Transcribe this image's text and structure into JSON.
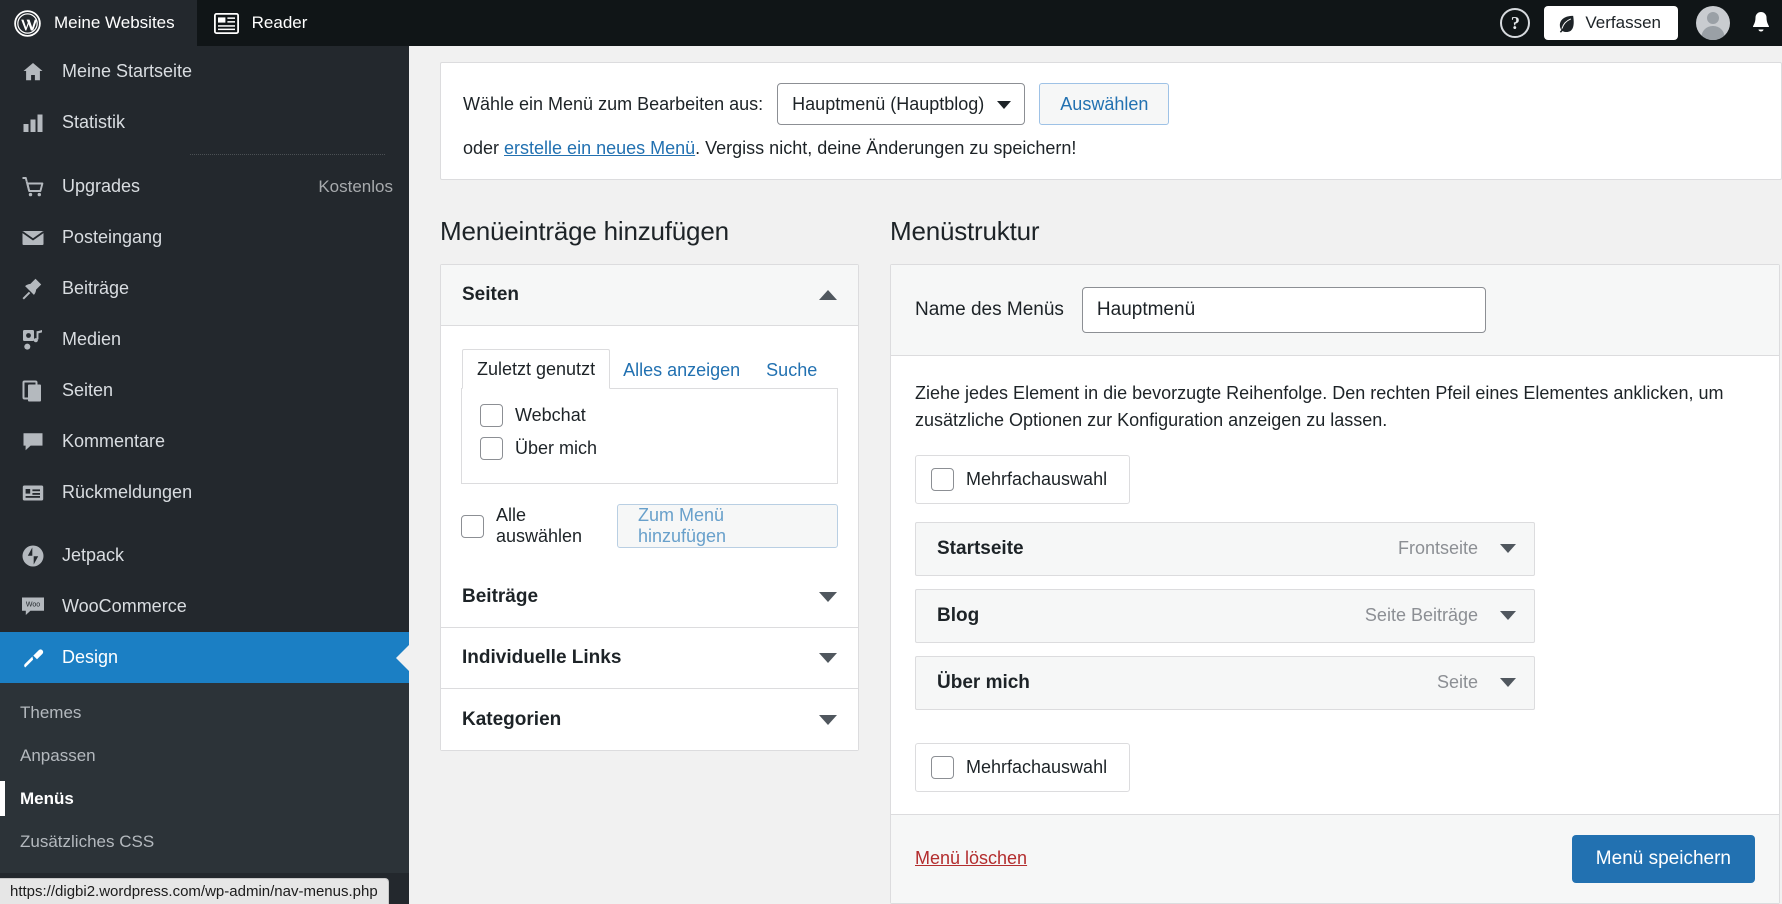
{
  "masterbar": {
    "sites_label": "Meine Websites",
    "reader_label": "Reader",
    "help_label": "?",
    "compose_label": "Verfassen"
  },
  "sidebar": {
    "items": [
      {
        "label": "Meine Startseite",
        "icon": "home-icon",
        "badge": ""
      },
      {
        "label": "Statistik",
        "icon": "bar-chart-icon",
        "badge": ""
      },
      {
        "label": "Upgrades",
        "icon": "cart-icon",
        "badge": "Kostenlos"
      },
      {
        "label": "Posteingang",
        "icon": "envelope-icon",
        "badge": ""
      },
      {
        "label": "Beiträge",
        "icon": "pin-icon",
        "badge": ""
      },
      {
        "label": "Medien",
        "icon": "media-icon",
        "badge": ""
      },
      {
        "label": "Seiten",
        "icon": "pages-icon",
        "badge": ""
      },
      {
        "label": "Kommentare",
        "icon": "comment-icon",
        "badge": ""
      },
      {
        "label": "Rückmeldungen",
        "icon": "feedback-icon",
        "badge": ""
      },
      {
        "label": "Jetpack",
        "icon": "jetpack-icon",
        "badge": ""
      },
      {
        "label": "WooCommerce",
        "icon": "woo-icon",
        "badge": ""
      }
    ],
    "selected": {
      "label": "Design",
      "icon": "brush-icon"
    },
    "submenu": [
      {
        "label": "Themes",
        "current": false
      },
      {
        "label": "Anpassen",
        "current": false
      },
      {
        "label": "Menüs",
        "current": true
      },
      {
        "label": "Zusätzliches CSS",
        "current": false
      }
    ]
  },
  "statusbar": {
    "url": "https://digbi2.wordpress.com/wp-admin/nav-menus.php"
  },
  "notice": {
    "prompt": "Wähle ein Menü zum Bearbeiten aus:",
    "selected_menu": "Hauptmenü (Hauptblog)",
    "select_button": "Auswählen",
    "second_line_prefix": "oder ",
    "second_line_link": "erstelle ein neues Menü",
    "second_line_suffix": ". Vergiss nicht, deine Änderungen zu speichern!"
  },
  "add_items": {
    "title": "Menüeinträge hinzufügen",
    "accordions": [
      {
        "label": "Seiten",
        "expanded": true
      },
      {
        "label": "Beiträge",
        "expanded": false
      },
      {
        "label": "Individuelle Links",
        "expanded": false
      },
      {
        "label": "Kategorien",
        "expanded": false
      }
    ],
    "tabs": [
      {
        "label": "Zuletzt genutzt",
        "active": true
      },
      {
        "label": "Alles anzeigen",
        "active": false
      },
      {
        "label": "Suche",
        "active": false
      }
    ],
    "pages": [
      {
        "label": "Webchat",
        "checked": false
      },
      {
        "label": "Über mich",
        "checked": false
      }
    ],
    "select_all_label": "Alle auswählen",
    "add_button": "Zum Menü hinzufügen"
  },
  "structure": {
    "title": "Menüstruktur",
    "name_label": "Name des Menüs",
    "name_value": "Hauptmenü",
    "hint": "Ziehe jedes Element in die bevorzugte Reihenfolge. Den rechten Pfeil eines Elementes anklicken, um zusätzliche Optionen zur Konfiguration anzeigen zu lassen.",
    "bulk_label_top": "Mehrfachauswahl",
    "bulk_label_bottom": "Mehrfachauswahl",
    "items": [
      {
        "title": "Startseite",
        "type": "Frontseite"
      },
      {
        "title": "Blog",
        "type": "Seite Beiträge"
      },
      {
        "title": "Über mich",
        "type": "Seite"
      }
    ],
    "delete_label": "Menü löschen",
    "save_label": "Menü speichern"
  },
  "colors": {
    "sidebar_bg": "#23282d",
    "selected_blue": "#1b7fc4",
    "primary_blue": "#2271b1",
    "link_blue": "#2271b1",
    "delete_red": "#b32d2e"
  }
}
